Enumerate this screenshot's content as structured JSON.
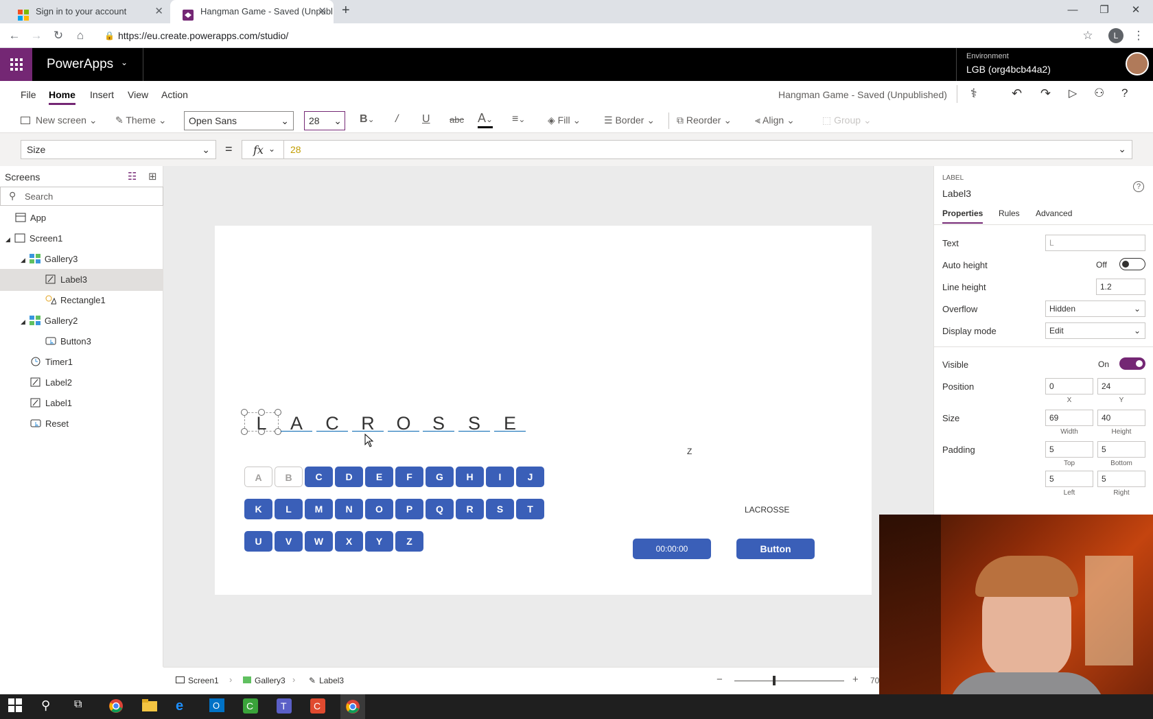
{
  "browser": {
    "tabs": [
      {
        "title": "Sign in to your account"
      },
      {
        "title": "Hangman Game - Saved (Unpubl"
      }
    ],
    "url": "https://eu.create.powerapps.com/studio/",
    "profile_initial": "L"
  },
  "app": {
    "brand": "PowerApps",
    "environment_label": "Environment",
    "environment_name": "LGB (org4bcb44a2)",
    "brand_color": "#742774"
  },
  "menu": {
    "items": [
      "File",
      "Home",
      "Insert",
      "View",
      "Action"
    ],
    "active": "Home",
    "doc_status": "Hangman Game - Saved (Unpublished)"
  },
  "ribbon": {
    "new_screen": "New screen",
    "theme": "Theme",
    "font": "Open Sans",
    "font_size": "28",
    "fill": "Fill",
    "border": "Border",
    "reorder": "Reorder",
    "align": "Align",
    "group": "Group"
  },
  "formula": {
    "property": "Size",
    "equals": "=",
    "fx": "fx",
    "value": "28"
  },
  "tree": {
    "title": "Screens",
    "search_placeholder": "Search",
    "items": [
      {
        "label": "App"
      },
      {
        "label": "Screen1"
      },
      {
        "label": "Gallery3"
      },
      {
        "label": "Label3"
      },
      {
        "label": "Rectangle1"
      },
      {
        "label": "Gallery2"
      },
      {
        "label": "Button3"
      },
      {
        "label": "Timer1"
      },
      {
        "label": "Label2"
      },
      {
        "label": "Label1"
      },
      {
        "label": "Reset"
      }
    ],
    "selected": "Label3"
  },
  "canvas": {
    "word_letters": [
      "L",
      "A",
      "C",
      "R",
      "O",
      "S",
      "S",
      "E"
    ],
    "keyboard_row1": [
      "A",
      "B",
      "C",
      "D",
      "E",
      "F",
      "G",
      "H",
      "I",
      "J"
    ],
    "keyboard_row2": [
      "K",
      "L",
      "M",
      "N",
      "O",
      "P",
      "Q",
      "R",
      "S",
      "T"
    ],
    "keyboard_row3": [
      "U",
      "V",
      "W",
      "X",
      "Y",
      "Z"
    ],
    "disabled_keys": [
      "A",
      "B"
    ],
    "z_label": "Z",
    "answer_label": "LACROSSE",
    "timer_text": "00:00:00",
    "button_text": "Button",
    "button_color": "#3a5fb8"
  },
  "props": {
    "kind": "LABEL",
    "name": "Label3",
    "tabs": [
      "Properties",
      "Rules",
      "Advanced"
    ],
    "active_tab": "Properties",
    "text_label": "Text",
    "text_value": "L",
    "auto_height_label": "Auto height",
    "auto_height_value": "Off",
    "line_height_label": "Line height",
    "line_height_value": "1.2",
    "overflow_label": "Overflow",
    "overflow_value": "Hidden",
    "display_mode_label": "Display mode",
    "display_mode_value": "Edit",
    "visible_label": "Visible",
    "visible_value": "On",
    "position_label": "Position",
    "x": "0",
    "y": "24",
    "x_label": "X",
    "y_label": "Y",
    "size_label": "Size",
    "width": "69",
    "height": "40",
    "width_label": "Width",
    "height_label": "Height",
    "padding_label": "Padding",
    "pad_top": "5",
    "pad_bottom": "5",
    "pad_left": "5",
    "pad_right": "5",
    "top_label": "Top",
    "bottom_label": "Bottom",
    "left_label": "Left",
    "right_label": "Right"
  },
  "status": {
    "crumbs": [
      "Screen1",
      "Gallery3",
      "Label3"
    ],
    "zoom_text": "70"
  }
}
